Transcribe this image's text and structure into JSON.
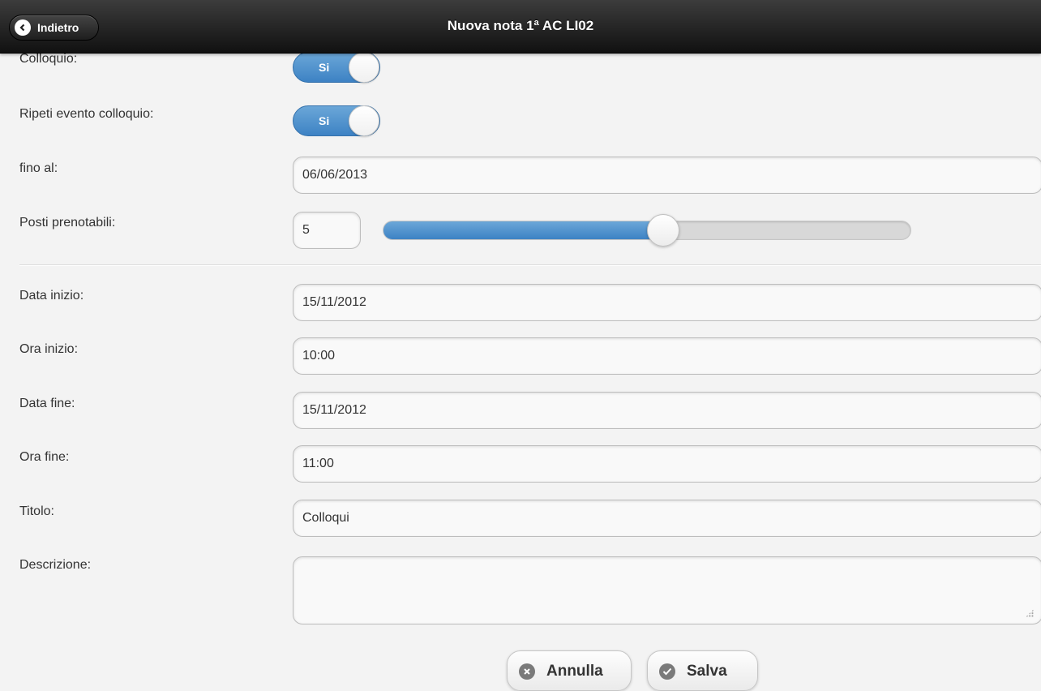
{
  "header": {
    "back_label": "Indietro",
    "title": "Nuova nota 1ª AC LI02"
  },
  "form": {
    "colloquio": {
      "label": "Colloquio:",
      "switch_label": "Si",
      "on": true
    },
    "ripeti": {
      "label": "Ripeti evento colloquio:",
      "switch_label": "Si",
      "on": true
    },
    "fino_al": {
      "label": "fino al:",
      "value": "06/06/2013"
    },
    "posti": {
      "label": "Posti prenotabili:",
      "value": "5",
      "slider_fraction": 0.53
    },
    "data_inizio": {
      "label": "Data inizio:",
      "value": "15/11/2012"
    },
    "ora_inizio": {
      "label": "Ora inizio:",
      "value": "10:00"
    },
    "data_fine": {
      "label": "Data fine:",
      "value": "15/11/2012"
    },
    "ora_fine": {
      "label": "Ora fine:",
      "value": "11:00"
    },
    "titolo": {
      "label": "Titolo:",
      "value": "Colloqui"
    },
    "descrizione": {
      "label": "Descrizione:",
      "value": ""
    }
  },
  "actions": {
    "cancel_label": "Annulla",
    "save_label": "Salva"
  },
  "icons": {
    "back": "chevron-left-icon",
    "cancel": "delete-icon",
    "save": "check-icon"
  },
  "colors": {
    "accent": "#3d82c4",
    "header": "#1e1e1e"
  }
}
